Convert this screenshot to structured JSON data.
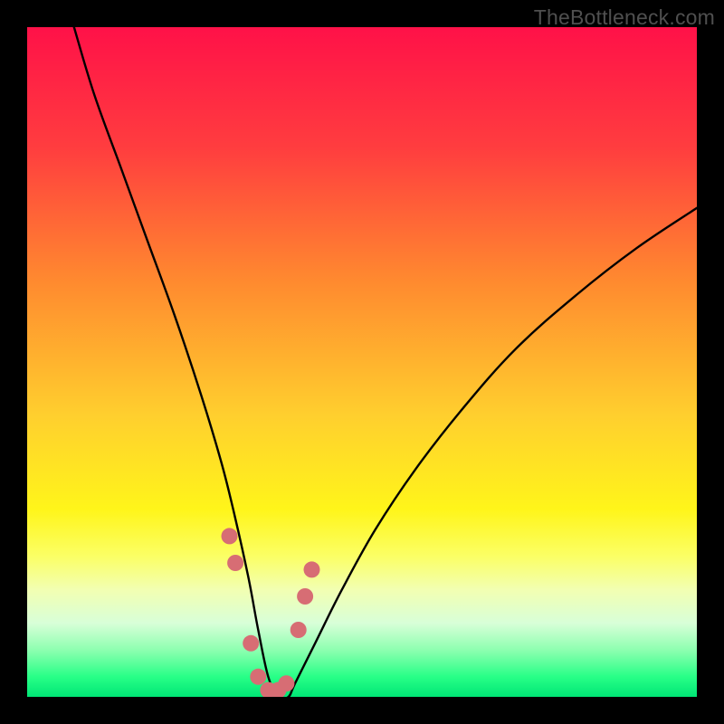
{
  "watermark": "TheBottleneck.com",
  "chart_data": {
    "type": "line",
    "title": "",
    "xlabel": "",
    "ylabel": "",
    "xlim": [
      0,
      100
    ],
    "ylim": [
      0,
      100
    ],
    "gradient_stops": [
      {
        "offset": 0,
        "color": "#ff1148"
      },
      {
        "offset": 18,
        "color": "#ff3d3f"
      },
      {
        "offset": 38,
        "color": "#ff8a2f"
      },
      {
        "offset": 58,
        "color": "#ffcf2e"
      },
      {
        "offset": 72,
        "color": "#fff51a"
      },
      {
        "offset": 79,
        "color": "#fbff65"
      },
      {
        "offset": 84,
        "color": "#f2ffb2"
      },
      {
        "offset": 89,
        "color": "#d8ffd8"
      },
      {
        "offset": 93,
        "color": "#8dffb0"
      },
      {
        "offset": 97,
        "color": "#28ff87"
      },
      {
        "offset": 100,
        "color": "#00e675"
      }
    ],
    "series": [
      {
        "name": "curve",
        "x": [
          7,
          10,
          14,
          18,
          22,
          26,
          29,
          31,
          33,
          34.5,
          36,
          37.5,
          39,
          40,
          43,
          47,
          52,
          58,
          65,
          73,
          82,
          91,
          100
        ],
        "y": [
          100,
          90,
          79,
          68,
          57,
          45,
          35,
          27,
          18,
          10,
          3,
          0,
          0,
          2,
          8,
          16,
          25,
          34,
          43,
          52,
          60,
          67,
          73
        ]
      }
    ],
    "markers": {
      "color": "#d76d74",
      "x": [
        30.2,
        31.1,
        33.4,
        34.5,
        36.0,
        37.5,
        38.7,
        40.5,
        41.5,
        42.5
      ],
      "y": [
        24,
        20,
        8,
        3,
        1,
        1,
        2,
        10,
        15,
        19
      ]
    }
  }
}
